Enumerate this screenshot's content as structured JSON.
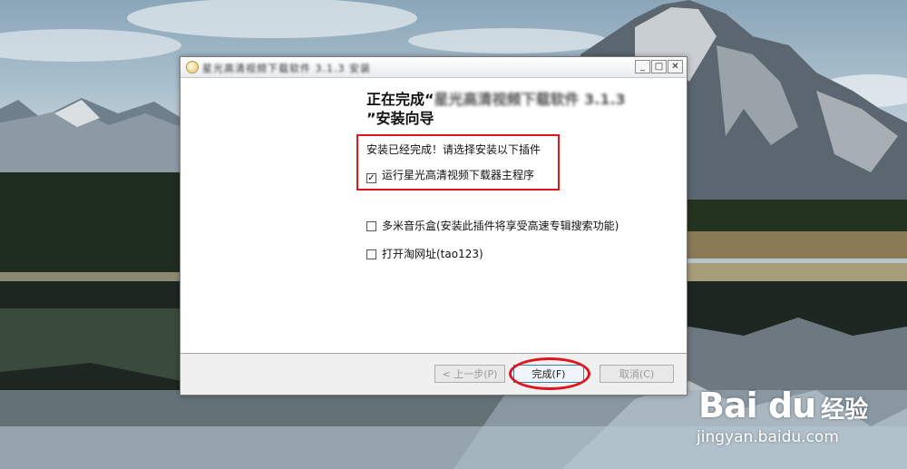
{
  "window": {
    "title": "星光高清视频下载软件 3.1.3 安装",
    "heading_prefix": "正在完成“",
    "heading_app": "星光高清视频下载软件 3.1.3",
    "heading_suffix": "”安装向导",
    "controls": {
      "minimize": "_",
      "maximize": "□",
      "close": "✕"
    }
  },
  "content": {
    "status": "安装已经完成！请选择安装以下插件",
    "options": [
      {
        "label": "运行星光高清视频下载器主程序",
        "checked": true
      },
      {
        "label": "多米音乐盒(安装此插件将享受高速专辑搜索功能)",
        "checked": false
      },
      {
        "label": "打开淘网址(tao123)",
        "checked": false
      }
    ]
  },
  "buttons": {
    "back": "< 上一步(P)",
    "finish": "完成(F)",
    "cancel": "取消(C)"
  },
  "watermark": {
    "logo": "Bai du",
    "logo_cn": "经验",
    "url": "jingyan.baidu.com"
  },
  "colors": {
    "highlight": "#e0141d",
    "window_bg": "#f0f0f0"
  }
}
